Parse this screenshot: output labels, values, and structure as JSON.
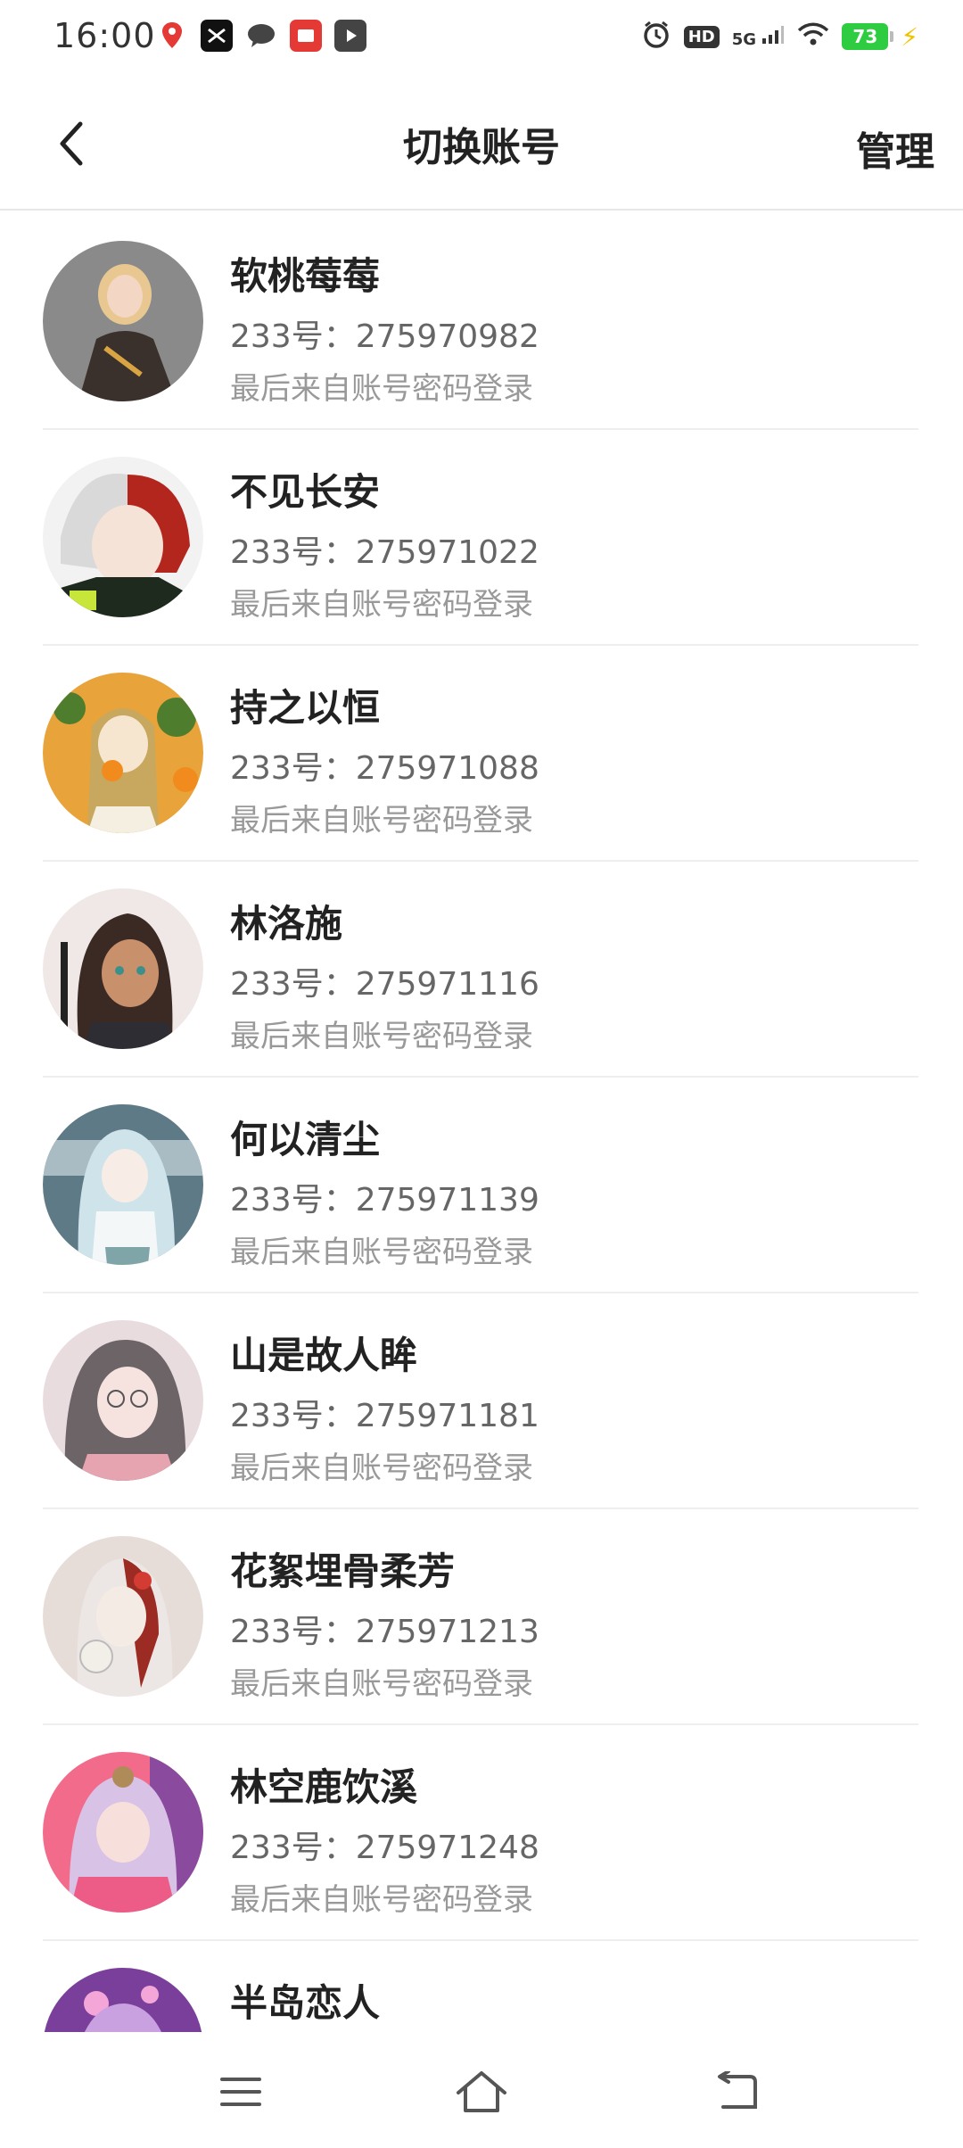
{
  "status_bar": {
    "time": "16:00",
    "network": "5G",
    "hd": "HD",
    "battery": "73"
  },
  "header": {
    "title": "切换账号",
    "manage_label": "管理"
  },
  "accounts": [
    {
      "name": "软桃莓莓",
      "id_text": "233号：275970982",
      "login": "最后来自账号密码登录"
    },
    {
      "name": "不见长安",
      "id_text": "233号：275971022",
      "login": "最后来自账号密码登录"
    },
    {
      "name": "持之以恒",
      "id_text": "233号：275971088",
      "login": "最后来自账号密码登录"
    },
    {
      "name": "林洛施",
      "id_text": "233号：275971116",
      "login": "最后来自账号密码登录"
    },
    {
      "name": "何以清尘",
      "id_text": "233号：275971139",
      "login": "最后来自账号密码登录"
    },
    {
      "name": "山是故人眸",
      "id_text": "233号：275971181",
      "login": "最后来自账号密码登录"
    },
    {
      "name": "花絮埋骨柔芳",
      "id_text": "233号：275971213",
      "login": "最后来自账号密码登录"
    },
    {
      "name": "林空鹿饮溪",
      "id_text": "233号：275971248",
      "login": "最后来自账号密码登录"
    },
    {
      "name": "半岛恋人"
    }
  ]
}
